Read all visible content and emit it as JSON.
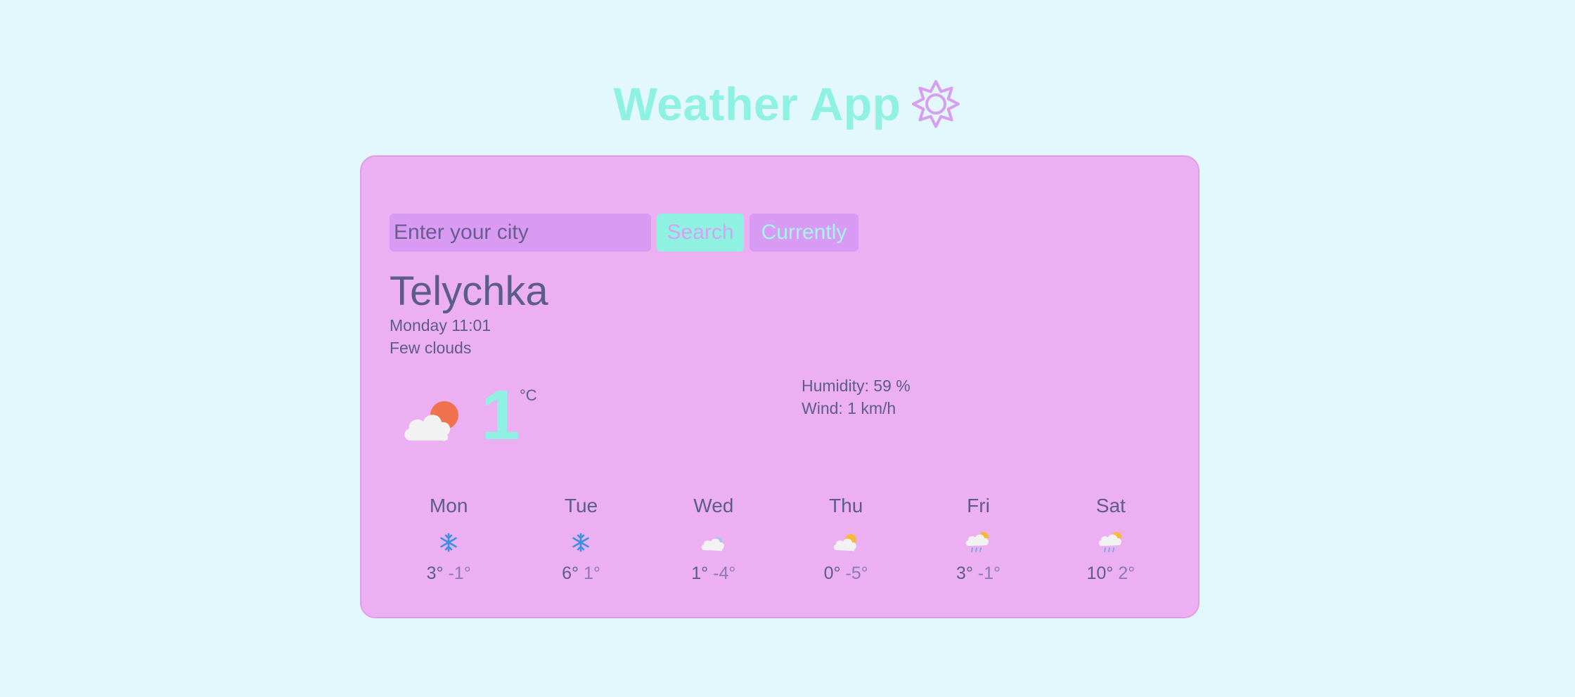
{
  "header": {
    "title": "Weather App",
    "icon": "sun-outline-icon"
  },
  "search": {
    "placeholder": "Enter your city",
    "value": "",
    "search_label": "Search",
    "current_label": "Currently"
  },
  "current": {
    "city": "Telychka",
    "datetime": "Monday 11:01",
    "description": "Few clouds",
    "icon": "few-clouds-day-icon",
    "temperature": "1",
    "unit": "°C",
    "humidity": "Humidity: 59 %",
    "wind": "Wind: 1 km/h"
  },
  "forecast": [
    {
      "day": "Mon",
      "icon": "snowflake-icon",
      "max": "3°",
      "min": "-1°"
    },
    {
      "day": "Tue",
      "icon": "snowflake-icon",
      "max": "6°",
      "min": "1°"
    },
    {
      "day": "Wed",
      "icon": "cloudy-icon",
      "max": "1°",
      "min": "-4°"
    },
    {
      "day": "Thu",
      "icon": "partly-cloudy-icon",
      "max": "0°",
      "min": "-5°"
    },
    {
      "day": "Fri",
      "icon": "rain-sun-icon",
      "max": "3°",
      "min": "-1°"
    },
    {
      "day": "Sat",
      "icon": "rain-sun-icon",
      "max": "10°",
      "min": "2°"
    }
  ],
  "colors": {
    "background": "#e3f8fd",
    "card": "#ecb0f2",
    "accent_teal": "#8ff1e1",
    "accent_purple": "#d89af3",
    "text": "#5b5c8a"
  }
}
